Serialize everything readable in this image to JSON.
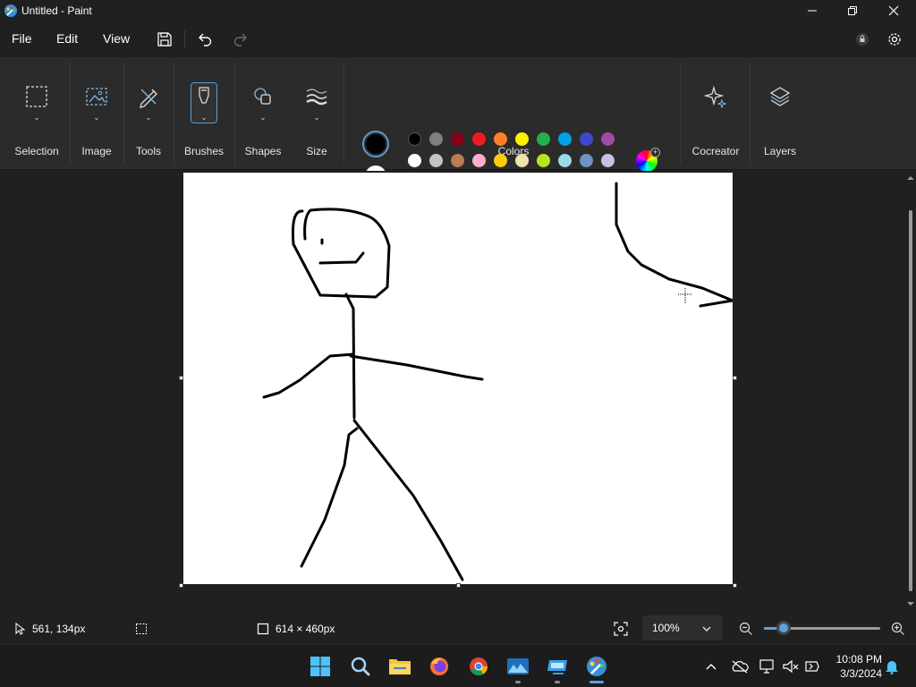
{
  "titlebar": {
    "title": "Untitled - Paint"
  },
  "menu": {
    "file": "File",
    "edit": "Edit",
    "view": "View"
  },
  "ribbon": {
    "selection": "Selection",
    "image": "Image",
    "tools": "Tools",
    "brushes": "Brushes",
    "shapes": "Shapes",
    "size": "Size",
    "colors": "Colors",
    "cocreator": "Cocreator",
    "layers": "Layers"
  },
  "colors": {
    "primary": "#000000",
    "secondary": "#ffffff",
    "accent": "#5a9bd5",
    "palette_row1": [
      "#000000",
      "#7f7f7f",
      "#880015",
      "#ed1c24",
      "#ff7f27",
      "#fff200",
      "#22b14c",
      "#00a2e8",
      "#3f48cc",
      "#a349a4"
    ],
    "palette_row2": [
      "#ffffff",
      "#c3c3c3",
      "#b97a57",
      "#ffaec9",
      "#ffc90e",
      "#efe4b0",
      "#b5e61d",
      "#99d9ea",
      "#7092be",
      "#c8bfe7"
    ],
    "custom_slots": 10
  },
  "status": {
    "cursor_pos": "561, 134px",
    "canvas_size": "614 × 460px",
    "zoom": "100%",
    "zoom_fraction": 0.17
  },
  "taskbar": {
    "time": "10:08 PM",
    "date": "3/3/2024",
    "icons": [
      "windows-start-icon",
      "search-icon",
      "file-explorer-icon",
      "firefox-icon",
      "chrome-icon",
      "photos-icon",
      "remote-desktop-icon",
      "paint-icon"
    ]
  }
}
